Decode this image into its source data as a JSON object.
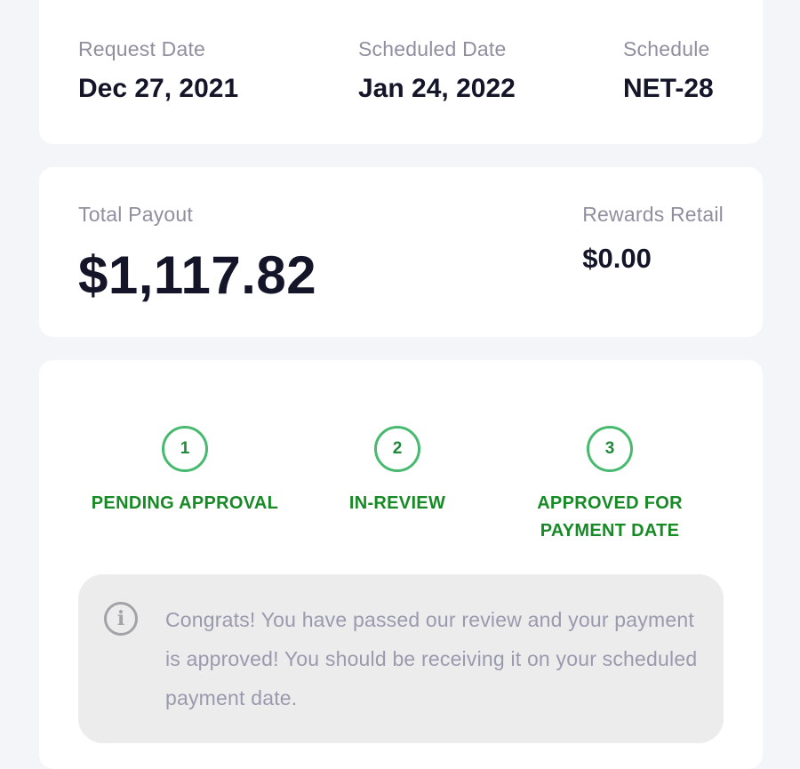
{
  "dates": {
    "request_label": "Request Date",
    "request_value": "Dec 27, 2021",
    "scheduled_label": "Scheduled Date",
    "scheduled_value": "Jan 24, 2022",
    "schedule_label": "Schedule",
    "schedule_value": "NET-28"
  },
  "payout": {
    "total_label": "Total Payout",
    "total_value": "$1,117.82",
    "rewards_label": "Rewards Retail",
    "rewards_value": "$0.00"
  },
  "steps": [
    {
      "number": "1",
      "label": "PENDING APPROVAL"
    },
    {
      "number": "2",
      "label": "IN-REVIEW"
    },
    {
      "number": "3",
      "label": "APPROVED FOR PAYMENT DATE"
    }
  ],
  "info": {
    "icon": "info-icon",
    "icon_glyph": "i",
    "message": "Congrats! You have passed our review and your payment is approved! You should be receiving it on your scheduled payment date."
  },
  "colors": {
    "step_green": "#178a25",
    "step_circle": "#48ba6f",
    "label_gray": "#8f8fa0",
    "value_dark": "#15152a"
  }
}
